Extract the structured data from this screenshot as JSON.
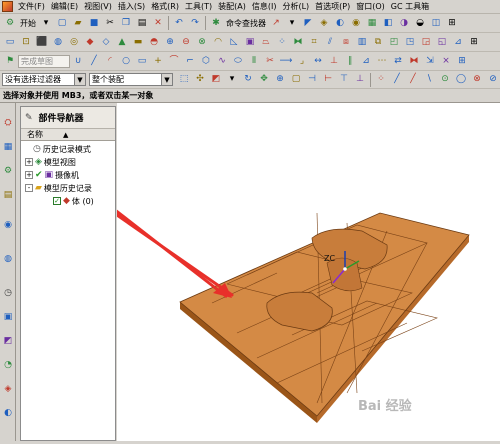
{
  "menubar": {
    "items": [
      "文件(F)",
      "编辑(E)",
      "视图(V)",
      "插入(S)",
      "格式(R)",
      "工具(T)",
      "装配(A)",
      "信息(I)",
      "分析(L)",
      "首选项(P)",
      "窗口(O)",
      "GC 工具箱"
    ]
  },
  "toolbar1": {
    "start_label": "开始",
    "finder_label": "命令查找器"
  },
  "toolbar2": {
    "sketch_label": "完成草图"
  },
  "selection": {
    "filter_value": "没有选择过滤器",
    "assembly_value": "整个装配"
  },
  "status": {
    "prompt": "选择对象并使用 MB3，或者双击某一对象"
  },
  "navigator": {
    "title": "部件导航器",
    "column_name": "名称",
    "rows": [
      {
        "label": "历史记录模式",
        "expander": "",
        "icon": "clock-icon"
      },
      {
        "label": "模型视图",
        "expander": "+",
        "icon": "model-view-icon"
      },
      {
        "label": "摄像机",
        "expander": "+",
        "icon": "camera-icon"
      },
      {
        "label": "模型历史记录",
        "expander": "-",
        "icon": "folder-icon"
      },
      {
        "label": "体 (0)",
        "expander": "",
        "icon": "body-icon"
      }
    ]
  },
  "viewport": {
    "triad_label": "ZC",
    "watermark": "Bai 经验"
  },
  "colors": {
    "part_top": "#d48a45",
    "part_side": "#b46a2c",
    "arrow": "#e8302a"
  }
}
